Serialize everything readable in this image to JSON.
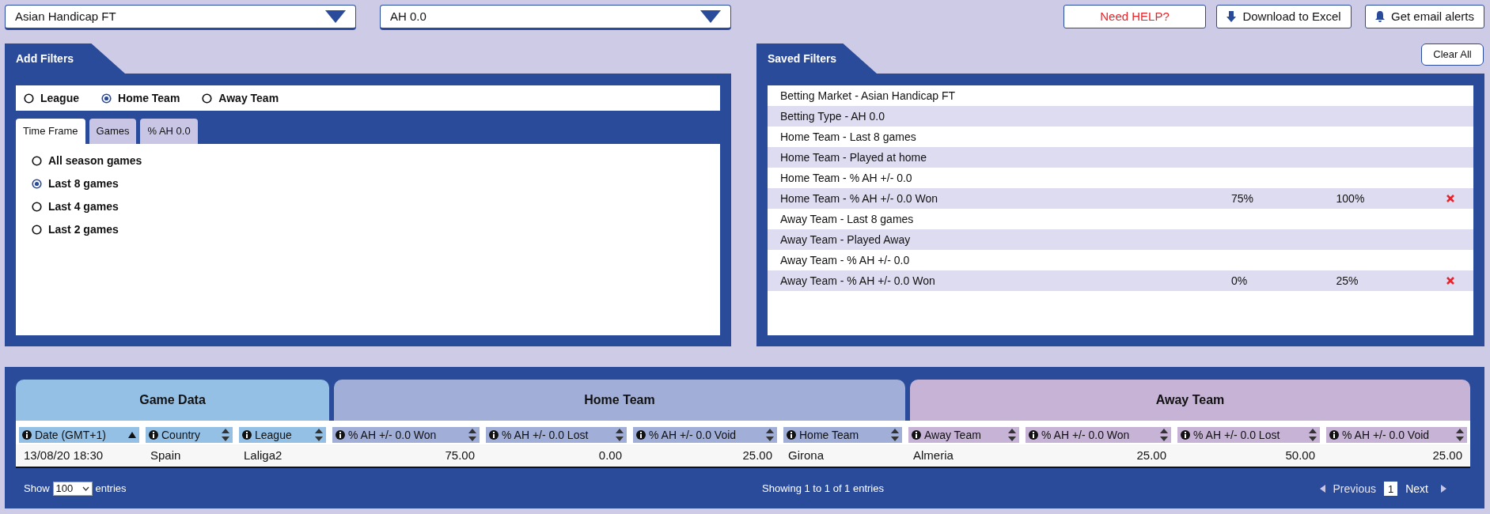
{
  "selectors": [
    {
      "value": "Asian Handicap FT"
    },
    {
      "value": "AH 0.0"
    }
  ],
  "top_buttons": [
    {
      "kind": "help",
      "label": "Need HELP?"
    },
    {
      "kind": "download",
      "label": "Download to Excel"
    },
    {
      "kind": "alerts",
      "label": "Get email alerts"
    }
  ],
  "add_filters": {
    "title": "Add Filters",
    "scope": [
      {
        "label": "League",
        "selected": false
      },
      {
        "label": "Home Team",
        "selected": true
      },
      {
        "label": "Away Team",
        "selected": false
      }
    ],
    "tabs": [
      {
        "label": "Time Frame",
        "selected": true
      },
      {
        "label": "Games",
        "selected": false
      },
      {
        "label": "% AH 0.0",
        "selected": false
      }
    ],
    "options": [
      {
        "label": "All season games",
        "selected": false
      },
      {
        "label": "Last 8 games",
        "selected": true
      },
      {
        "label": "Last 4 games",
        "selected": false
      },
      {
        "label": "Last 2 games",
        "selected": false
      }
    ]
  },
  "saved_filters": {
    "title": "Saved Filters",
    "clear_button": "Clear All",
    "items": [
      {
        "label": "Betting Market - Asian Handicap FT"
      },
      {
        "label": "Betting Type - AH 0.0"
      },
      {
        "label": "Home Team - Last 8 games"
      },
      {
        "label": "Home Team - Played at home"
      },
      {
        "label": "Home Team - % AH +/- 0.0"
      },
      {
        "label": "Home Team - % AH +/- 0.0 Won",
        "min": "75%",
        "max": "100%",
        "removable": true
      },
      {
        "label": "Away Team - Last 8 games"
      },
      {
        "label": "Away Team - Played Away"
      },
      {
        "label": "Away Team - % AH +/- 0.0"
      },
      {
        "label": "Away Team - % AH +/- 0.0 Won",
        "min": "0%",
        "max": "25%",
        "removable": true
      }
    ]
  },
  "table": {
    "groups": [
      {
        "label": "Game Data",
        "columns": [
          {
            "label": "Date (GMT+1)",
            "sorted": true
          },
          {
            "label": "Country",
            "sorted": false
          },
          {
            "label": "League",
            "sorted": false
          }
        ]
      },
      {
        "label": "Home Team",
        "columns": [
          {
            "label": "% AH +/- 0.0 Won",
            "sorted": false
          },
          {
            "label": "% AH +/- 0.0 Lost",
            "sorted": false
          },
          {
            "label": "% AH +/- 0.0 Void",
            "sorted": false
          },
          {
            "label": "Home Team",
            "sorted": false
          }
        ]
      },
      {
        "label": "Away Team",
        "columns": [
          {
            "label": "Away Team",
            "sorted": false
          },
          {
            "label": "% AH +/- 0.0 Won",
            "sorted": false
          },
          {
            "label": "% AH +/- 0.0 Lost",
            "sorted": false
          },
          {
            "label": "% AH +/- 0.0 Void",
            "sorted": false
          }
        ]
      }
    ],
    "rows": [
      [
        {
          "kind": "text",
          "value": "13/08/20 18:30"
        },
        {
          "kind": "text",
          "value": "Spain"
        },
        {
          "kind": "text",
          "value": "Laliga2"
        },
        {
          "kind": "number",
          "value": "75.00"
        },
        {
          "kind": "number",
          "value": "0.00"
        },
        {
          "kind": "number",
          "value": "25.00"
        },
        {
          "kind": "text",
          "value": "Girona"
        },
        {
          "kind": "text",
          "value": "Almeria"
        },
        {
          "kind": "number",
          "value": "25.00"
        },
        {
          "kind": "number",
          "value": "50.00"
        },
        {
          "kind": "number",
          "value": "25.00"
        }
      ]
    ],
    "length": {
      "before": "Show",
      "value": "100",
      "after": "entries"
    },
    "info": "Showing 1 to 1 of 1 entries",
    "pagination": {
      "previous": "Previous",
      "pages": [
        {
          "label": "1",
          "selected": true
        }
      ],
      "next": "Next"
    }
  }
}
